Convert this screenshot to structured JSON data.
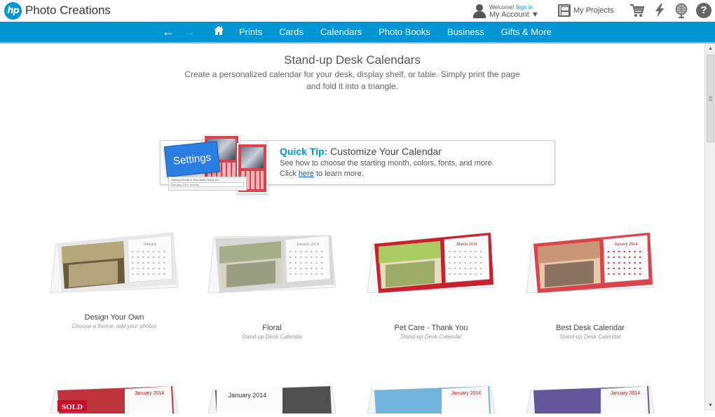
{
  "header": {
    "logo_text": "hp",
    "brand": "Photo Creations",
    "welcome": "Welcome!",
    "sign_in": "Sign in",
    "my_account": "My Account ▼",
    "my_projects": "My Projects",
    "icons": [
      "cart-icon",
      "lightning-icon",
      "globe-icon",
      "help-icon"
    ]
  },
  "nav": {
    "back": "←",
    "forward": "→",
    "home": "⌂",
    "links": [
      "Prints",
      "Cards",
      "Calendars",
      "Photo Books",
      "Business",
      "Gifts & More"
    ]
  },
  "page": {
    "title": "Stand-up Desk Calendars",
    "description": "Create a personalized calendar for your desk, display shelf, or table. Simply print the page and fold it into a triangle."
  },
  "tip": {
    "settings_label": "Settings",
    "form_labels": "Starting Month & Year   Week Starts On",
    "form_values": "January   2014   Sunday",
    "label": "Quick Tip",
    "title": "Customize Your Calendar",
    "line1": "See how to choose the starting month, colors, fonts, and more.",
    "line2_pre": "Click",
    "line2_link": "here",
    "line2_post": "to learn more."
  },
  "products": [
    {
      "name": "Design Your Own",
      "subtitle": "Choose a theme, add your photos",
      "calendar_month": "January",
      "accent": "#e8e8e8"
    },
    {
      "name": "Floral",
      "subtitle": "Stand-up Desk Calendar",
      "calendar_month": "January 2014",
      "accent": "#d8d8d8"
    },
    {
      "name": "Pet Care - Thank You",
      "subtitle": "Stand-up Desk Calendar",
      "calendar_month": "March 2014",
      "accent": "#c8202f"
    },
    {
      "name": "Best Desk Calendar",
      "subtitle": "Stand-up Desk Calendar",
      "calendar_month": "January 2014",
      "accent": "#d9434e"
    }
  ],
  "products_row2": [
    {
      "badge": "SOLD",
      "calendar_month": "January 2014",
      "accent": "#b5121b"
    },
    {
      "calendar_month": "January 2014",
      "accent": "#333333"
    },
    {
      "calendar_month": "January 2014",
      "accent": "#5aa8d8"
    },
    {
      "calendar_month": "January 2014",
      "accent": "#4a3a8a"
    }
  ],
  "colors": {
    "brand_blue": "#0096d6",
    "link": "#0a5ca8"
  },
  "scrollbar": {
    "up": "▲",
    "down": "▼"
  }
}
